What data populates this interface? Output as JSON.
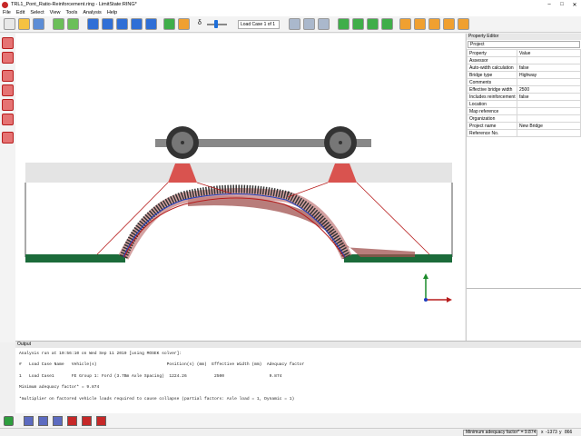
{
  "window": {
    "title": "TRL1_Pont_Ratio-Reinforcement.ring - LimitState:RING*",
    "controls": [
      "–",
      "□",
      "✕"
    ]
  },
  "menu": [
    "File",
    "Edit",
    "Select",
    "View",
    "Tools",
    "Analysis",
    "Help"
  ],
  "toolbar": {
    "zoom_symbol": "δ",
    "load_case": "Load Case 1 of 1",
    "icons": [
      "new-icon",
      "open-icon",
      "save-icon",
      "undo-icon",
      "redo-icon",
      "select-icon",
      "pointer-icon",
      "rotate-icon",
      "pan-icon",
      "zoom-icon",
      "run-icon",
      "stop-icon",
      "zoom-in-icon",
      "zoom-out-icon",
      "zoom-fit-icon",
      "add-span-icon",
      "add-pier-icon",
      "add-fill-icon",
      "add-load-icon",
      "add-vehicle-icon",
      "help-icon"
    ]
  },
  "property_editor": {
    "title": "Property Editor",
    "selected": "Project",
    "headers": [
      "Property",
      "Value"
    ],
    "rows": [
      [
        "Assessor",
        ""
      ],
      [
        "Auto-width calculation",
        "false"
      ],
      [
        "Bridge type",
        "Highway"
      ],
      [
        "Comments",
        ""
      ],
      [
        "Effective bridge width",
        "2500"
      ],
      [
        "Includes reinforcement",
        "false"
      ],
      [
        "Location",
        ""
      ],
      [
        "Map reference",
        ""
      ],
      [
        "Organization",
        ""
      ],
      [
        "Project name",
        "New Bridge"
      ],
      [
        "Reference No.",
        ""
      ]
    ]
  },
  "output": {
    "title": "Output",
    "lines": [
      "Analysis run at 10:56:10 on Wed Sep 11 2019 [using MOSEK solver]:",
      "",
      "#   Load Case Name   Vehicle(s)                            Position(s) (mm)  Effective Width (mm)  Adequacy factor",
      "",
      "1   Load Case1       FE Group 1: Ford (3.7Bm Axle Spacing)  1224.26           2500                  9.874",
      "",
      "Minimum adequacy factor* = 9.874",
      "",
      "*multiplier on factored vehicle loads required to cause collapse (partial factors: Axle load = 1, Dynamic = 1)"
    ]
  },
  "status": {
    "adequacy": "Minimum adequacy factor* = 9.874",
    "x": "-1373",
    "y": "866"
  },
  "colors": {
    "fill_red": "#d9534f",
    "ground_green": "#1b6b3a",
    "deck_gray": "#e4e4e4",
    "arch_dark_red": "#a0524f"
  }
}
